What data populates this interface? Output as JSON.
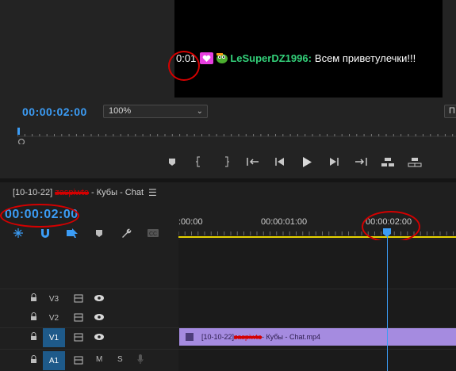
{
  "program_monitor": {
    "chat_overlay": {
      "time": "0:01",
      "username": "LeSuperDZ1996:",
      "message": "Всем приветулечки!!!"
    },
    "timecode": "00:00:02:00",
    "zoom": {
      "value": "100%",
      "options": [
        "100%"
      ]
    },
    "fit_label": "П",
    "transport": {
      "buttons": [
        "add-marker",
        "mark-in",
        "mark-out",
        "go-to-in",
        "step-back",
        "play",
        "step-forward",
        "go-to-out",
        "lift",
        "extract"
      ]
    }
  },
  "timeline": {
    "sequence_tab": "[10-10-22] ",
    "sequence_tab_scribbled": "zaspiwte",
    "sequence_tab_rest": " - Кубы - Chat",
    "timecode": "00:00:02:00",
    "ruler_labels": [
      ":00:00",
      "00:00:01:00",
      "00:00:02:00"
    ],
    "tracks": [
      {
        "label": "V3",
        "type": "video"
      },
      {
        "label": "V2",
        "type": "video"
      },
      {
        "label": "V1",
        "type": "video"
      },
      {
        "label": "A1",
        "type": "audio",
        "mute": "M",
        "solo": "S"
      }
    ],
    "clip": {
      "name_start": "[10-10-22] ",
      "name_scribbled": "zaspiwte",
      "name_rest": " - Кубы - Chat.mp4",
      "color": "#a58be0"
    }
  },
  "colors": {
    "accent_blue": "#3b9cf5",
    "annotation_red": "#d40000",
    "in_out_bar": "#e8d400"
  }
}
